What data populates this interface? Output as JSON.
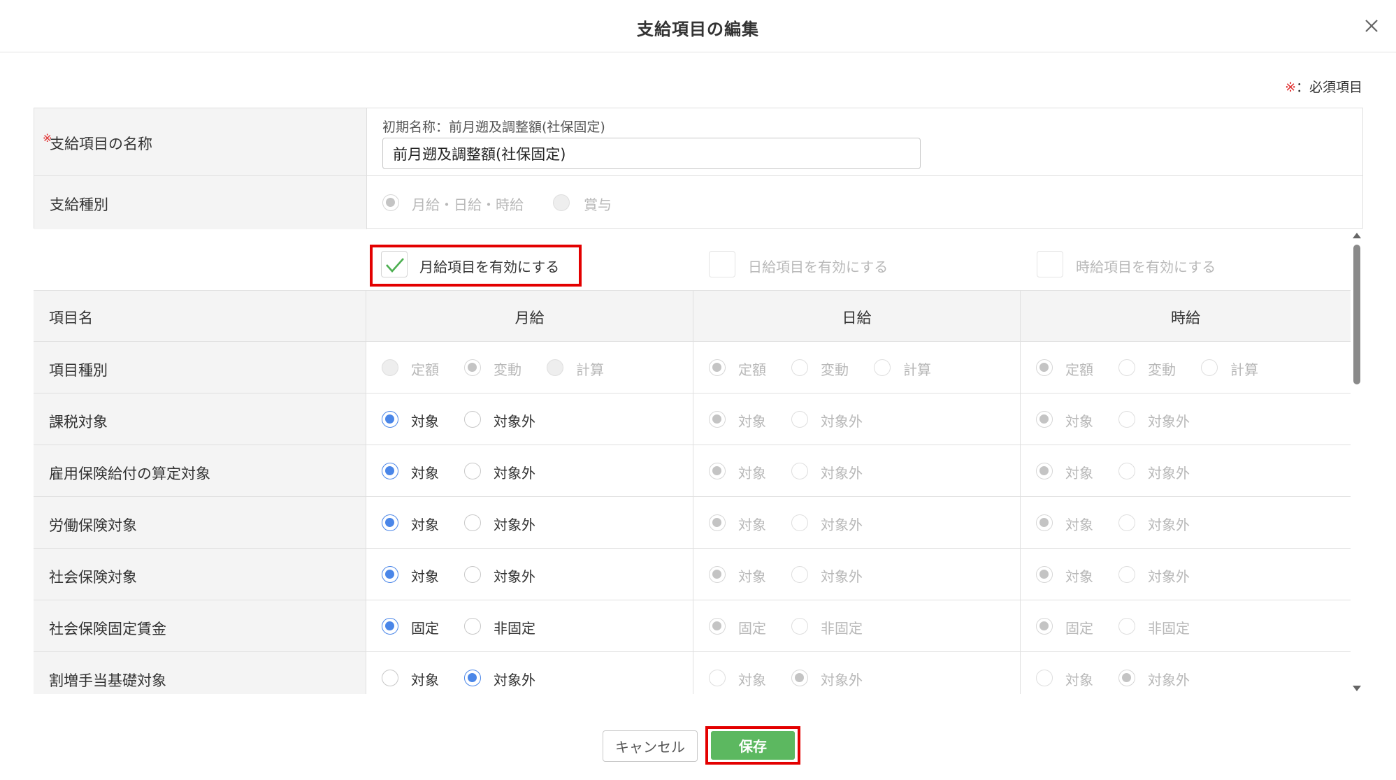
{
  "dialog": {
    "title": "支給項目の編集",
    "close_icon": "close-icon"
  },
  "required_note": {
    "mark": "※",
    "text": "：必須項目"
  },
  "name_field": {
    "label": "支給項目の名称",
    "required_mark": "※",
    "initial_name": "初期名称：前月遡及調整額(社保固定)",
    "value": "前月遡及調整額(社保固定)"
  },
  "payment_type": {
    "label": "支給種別",
    "options": [
      "月給・日給・時給",
      "賞与"
    ]
  },
  "enable_checkboxes": {
    "monthly": {
      "label": "月給項目を有効にする",
      "checked": true
    },
    "daily": {
      "label": "日給項目を有効にする",
      "checked": false
    },
    "hourly": {
      "label": "時給項目を有効にする",
      "checked": false
    }
  },
  "grid": {
    "header": {
      "label": "項目名",
      "col1": "月給",
      "col2": "日給",
      "col3": "時給"
    },
    "rows": [
      {
        "label": "項目種別",
        "options": [
          "定額",
          "変動",
          "計算"
        ]
      },
      {
        "label": "課税対象",
        "options": [
          "対象",
          "対象外"
        ]
      },
      {
        "label": "雇用保険給付の算定対象",
        "options": [
          "対象",
          "対象外"
        ]
      },
      {
        "label": "労働保険対象",
        "options": [
          "対象",
          "対象外"
        ]
      },
      {
        "label": "社会保険対象",
        "options": [
          "対象",
          "対象外"
        ]
      },
      {
        "label": "社会保険固定賃金",
        "options": [
          "固定",
          "非固定"
        ]
      },
      {
        "label": "割増手当基礎対象",
        "options": [
          "対象",
          "対象外"
        ]
      }
    ]
  },
  "footer": {
    "cancel_label": "キャンセル",
    "save_label": "保存"
  },
  "colors": {
    "accent_blue": "#4a86e8",
    "save_green": "#5cb860",
    "highlight_red": "#e30000",
    "check_green": "#4caf50",
    "required_red": "#e03030"
  }
}
